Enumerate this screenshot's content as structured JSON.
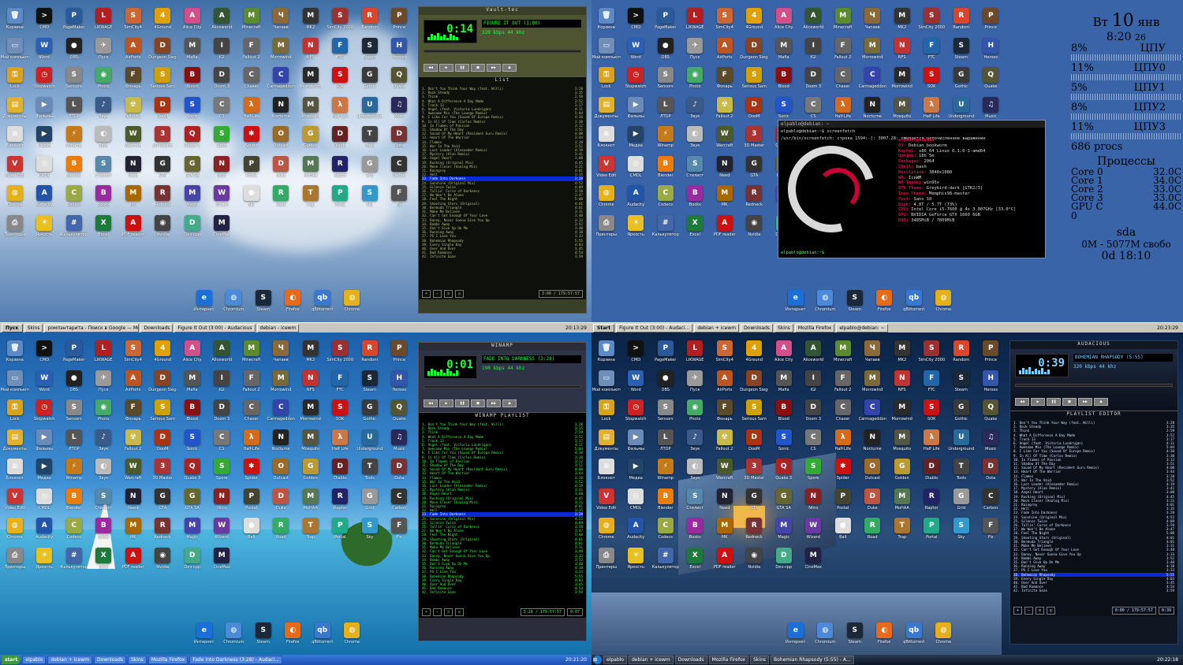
{
  "icons": [
    {
      "l": "Корзина",
      "c": "#5b8ac7",
      "g": "🗑"
    },
    {
      "l": "CMD",
      "c": "#111",
      "g": ">"
    },
    {
      "l": "PageMaker",
      "c": "#2b5a9a",
      "g": "P"
    },
    {
      "l": "LIKWAGE",
      "c": "#b02020",
      "g": "L"
    },
    {
      "l": "SimCity4",
      "c": "#cc6633",
      "g": "S"
    },
    {
      "l": "4Ground",
      "c": "#e0a000",
      "g": "4"
    },
    {
      "l": "Alice City",
      "c": "#d24f8a",
      "g": "A"
    },
    {
      "l": "Aliceworld",
      "c": "#335533",
      "g": "A"
    },
    {
      "l": "Minecraft",
      "c": "#5c8a2e",
      "g": "M"
    },
    {
      "l": "Чапаев",
      "c": "#8b6a3a",
      "g": "Ч"
    },
    {
      "l": "MK2",
      "c": "#333",
      "g": "M"
    },
    {
      "l": "SimCity 2000",
      "c": "#9b3030",
      "g": "S"
    },
    {
      "l": "Random",
      "c": "#d8462b",
      "g": "R"
    },
    {
      "l": "Prince",
      "c": "#6a4a2a",
      "g": "P"
    },
    {
      "l": "Мой компьютер",
      "c": "#6f8fb8",
      "g": "▭"
    },
    {
      "l": "Word",
      "c": "#2b5fb4",
      "g": "W"
    },
    {
      "l": "OBS",
      "c": "#222",
      "g": "●"
    },
    {
      "l": "Пуск",
      "c": "#999",
      "g": "✈"
    },
    {
      "l": "AirPorts",
      "c": "#bb5522",
      "g": "A"
    },
    {
      "l": "Dungeon Siege",
      "c": "#884422",
      "g": "D"
    },
    {
      "l": "Mafia",
      "c": "#555",
      "g": "M"
    },
    {
      "l": "IGI",
      "c": "#444",
      "g": "I"
    },
    {
      "l": "Fallout 2",
      "c": "#666",
      "g": "F"
    },
    {
      "l": "Morrowind",
      "c": "#7a6a3a",
      "g": "M"
    },
    {
      "l": "NFS",
      "c": "#c03333",
      "g": "N"
    },
    {
      "l": "FTC",
      "c": "#2266aa",
      "g": "F"
    },
    {
      "l": "Steam",
      "c": "#1b2838",
      "g": "S"
    },
    {
      "l": "Heroes",
      "c": "#3355aa",
      "g": "H"
    },
    {
      "l": "Lock",
      "c": "#d7a21e",
      "g": "⚿"
    },
    {
      "l": "Stopwatch",
      "c": "#c22",
      "g": "◷"
    },
    {
      "l": "Sensors",
      "c": "#888",
      "g": "S"
    },
    {
      "l": "Photo",
      "c": "#4a6",
      "g": "◉"
    },
    {
      "l": "Фонарь",
      "c": "#5a4a2a",
      "g": "F"
    },
    {
      "l": "Serious Sam",
      "c": "#d0a000",
      "g": "S"
    },
    {
      "l": "Blood",
      "c": "#8a1010",
      "g": "B"
    },
    {
      "l": "Doom 3",
      "c": "#444",
      "g": "D"
    },
    {
      "l": "Chaser",
      "c": "#666",
      "g": "C"
    },
    {
      "l": "Carmageddon",
      "c": "#3344aa",
      "g": "C"
    },
    {
      "l": "Morrowind",
      "c": "#2a2a2a",
      "g": "M"
    },
    {
      "l": "SOK",
      "c": "#c11",
      "g": "S"
    },
    {
      "l": "Gothic",
      "c": "#3a3a3a",
      "g": "G"
    },
    {
      "l": "Quake",
      "c": "#553",
      "g": "Q"
    },
    {
      "l": "Документы",
      "c": "#e0b030",
      "g": "▤"
    },
    {
      "l": "Фильмы",
      "c": "#6a8ab8",
      "g": "▶"
    },
    {
      "l": "ЛТОР",
      "c": "#555",
      "g": "L"
    },
    {
      "l": "Звук",
      "c": "#3a5a8a",
      "g": "♪"
    },
    {
      "l": "Fallout 2",
      "c": "#c9b94a",
      "g": "☢"
    },
    {
      "l": "DooM",
      "c": "#aa3311",
      "g": "D"
    },
    {
      "l": "Sonic",
      "c": "#2255cc",
      "g": "S"
    },
    {
      "l": "CS",
      "c": "#777",
      "g": "C"
    },
    {
      "l": "Half-Life",
      "c": "#d36b1a",
      "g": "λ"
    },
    {
      "l": "Nocturne",
      "c": "#222",
      "g": "N"
    },
    {
      "l": "Mosquito",
      "c": "#554",
      "g": "M"
    },
    {
      "l": "Half Life",
      "c": "#c74",
      "g": "λ"
    },
    {
      "l": "Underground",
      "c": "#2a6a9a",
      "g": "U"
    },
    {
      "l": "Music",
      "c": "#2a2a5a",
      "g": "♫"
    },
    {
      "l": "Блокнот",
      "c": "#ddd",
      "g": "≡"
    },
    {
      "l": "Медиа",
      "c": "#246",
      "g": "▶"
    },
    {
      "l": "Winamp",
      "c": "#c57a1a",
      "g": "⚡"
    },
    {
      "l": "Звук",
      "c": "#bbb",
      "g": "◐"
    },
    {
      "l": "Warcraft",
      "c": "#4a5a2a",
      "g": "W"
    },
    {
      "l": "3D Master",
      "c": "#a33",
      "g": "3"
    },
    {
      "l": "Quake 3",
      "c": "#a22",
      "g": "Q"
    },
    {
      "l": "Spore",
      "c": "#3a3",
      "g": "S"
    },
    {
      "l": "Spider",
      "c": "#c11",
      "g": "✱"
    },
    {
      "l": "Outcast",
      "c": "#9a6a2a",
      "g": "O"
    },
    {
      "l": "Golden",
      "c": "#b93",
      "g": "G"
    },
    {
      "l": "Diablo",
      "c": "#622",
      "g": "D"
    },
    {
      "l": "Tools",
      "c": "#444",
      "g": "T"
    },
    {
      "l": "Dota",
      "c": "#733",
      "g": "D"
    },
    {
      "l": "Video Edit",
      "c": "#c33",
      "g": "V"
    },
    {
      "l": "CMDL",
      "c": "#ddd",
      "g": "◎"
    },
    {
      "l": "Blender",
      "c": "#e87d0d",
      "g": "B"
    },
    {
      "l": "Стилист",
      "c": "#58a",
      "g": "S"
    },
    {
      "l": "Need",
      "c": "#223",
      "g": "N"
    },
    {
      "l": "GTA",
      "c": "#333",
      "g": "G"
    },
    {
      "l": "GTA SA",
      "c": "#663",
      "g": "G"
    },
    {
      "l": "Nitro",
      "c": "#822",
      "g": "N"
    },
    {
      "l": "Postal",
      "c": "#443",
      "g": "P"
    },
    {
      "l": "Duke",
      "c": "#b54",
      "g": "D"
    },
    {
      "l": "MoHAA",
      "c": "#575",
      "g": "M"
    },
    {
      "l": "Raptor",
      "c": "#226",
      "g": "R"
    },
    {
      "l": "Grid",
      "c": "#999",
      "g": "G"
    },
    {
      "l": "Carbon",
      "c": "#333",
      "g": "C"
    },
    {
      "l": "Chrome",
      "c": "#e4b01b",
      "g": "◍"
    },
    {
      "l": "Audacity",
      "c": "#2255aa",
      "g": "A"
    },
    {
      "l": "Codecs",
      "c": "#9a4",
      "g": "C"
    },
    {
      "l": "Books",
      "c": "#9a2aa0",
      "g": "B"
    },
    {
      "l": "MK",
      "c": "#a60",
      "g": "M"
    },
    {
      "l": "Redneck",
      "c": "#733",
      "g": "R"
    },
    {
      "l": "Magic",
      "c": "#44a",
      "g": "M"
    },
    {
      "l": "Wizard",
      "c": "#6a3aa0",
      "g": "W"
    },
    {
      "l": "Ball",
      "c": "#ddd",
      "g": "●"
    },
    {
      "l": "Road",
      "c": "#3a6",
      "g": "R"
    },
    {
      "l": "Trap",
      "c": "#a73",
      "g": "T"
    },
    {
      "l": "Portal",
      "c": "#2a8",
      "g": "P"
    },
    {
      "l": "Sky",
      "c": "#39c",
      "g": "S"
    },
    {
      "l": "Fix",
      "c": "#555",
      "g": "F"
    },
    {
      "l": "Принтеры",
      "c": "#888",
      "g": "⎙"
    },
    {
      "l": "Яркость",
      "c": "#e8c020",
      "g": "☀"
    },
    {
      "l": "Калькулятор",
      "c": "#46a",
      "g": "#"
    },
    {
      "l": "Excel",
      "c": "#1d7a3a",
      "g": "X"
    },
    {
      "l": "PDF reader",
      "c": "#c11",
      "g": "A"
    },
    {
      "l": "Nvidia",
      "c": "#444",
      "g": "◉"
    },
    {
      "l": "Dev-cpp",
      "c": "#4a8",
      "g": "D"
    },
    {
      "l": "CineMax",
      "c": "#224",
      "g": "M"
    }
  ],
  "bottom_icons": [
    {
      "l": "Интернет",
      "c": "#1c6fd6",
      "g": "e"
    },
    {
      "l": "Chromium",
      "c": "#4a8ad8",
      "g": "◍"
    },
    {
      "l": "Steam",
      "c": "#1b2838",
      "g": "S"
    },
    {
      "l": "Firefox",
      "c": "#e76a1b",
      "g": "◐"
    },
    {
      "l": "qBittorrent",
      "c": "#3a78d0",
      "g": "qb"
    },
    {
      "l": "Chrome",
      "c": "#e4b01b",
      "g": "◍"
    }
  ],
  "top_left": {
    "player_title": "Vault-tec",
    "time": "0:14",
    "marquee": "FIGURE IT OUT (3:00)",
    "kbps": "320",
    "khz": "44",
    "playlist_title": "List",
    "total": "3:00 / 179:57:57",
    "taskbar": {
      "start": "Пуск",
      "buttons": [
        "Skins",
        "ромпэнтарита - Поиск в Google — Mozill...",
        "Downloads",
        "Figure It Out (3:00) - Audacious",
        "debian - icewm"
      ],
      "clock": "20:13:29"
    }
  },
  "top_right": {
    "terminal": {
      "title": "elpablo@debian: ~",
      "cmd": "elpablo@debian:~$ screenfetch",
      "warn": "/usr/bin/screenfetch: строка 1594: [: 3007.28: ожидается целочисленное выражение",
      "user": "elpablo@debian",
      "info": [
        [
          "OS:",
          "Debian bookworm"
        ],
        [
          "Kernel:",
          "x86_64 Linux 6.1.0-1-amd64"
        ],
        [
          "Uptime:",
          "18h 5m"
        ],
        [
          "Packages:",
          "2064"
        ],
        [
          "Shell:",
          "bash"
        ],
        [
          "Resolution:",
          "3840x1080"
        ],
        [
          "WM:",
          "IceWM"
        ],
        [
          "WM Theme:",
          "win95x"
        ],
        [
          "GTK Theme:",
          "Greybird-dark [GTK2/3]"
        ],
        [
          "Icon Theme:",
          "Memphis98-master"
        ],
        [
          "Font:",
          "Sans 10"
        ],
        [
          "Disk:",
          "4.8T / 5.7T (73%)"
        ],
        [
          "CPU:",
          "Intel Core i5-7600 @ 4x 3.007GHz [33.0°C]"
        ],
        [
          "GPU:",
          "NVIDIA GeForce GTX 1060 6GB"
        ],
        [
          "RAM:",
          "3485MiB / 7809MiB"
        ]
      ],
      "prompt": "elpablo@debian:~$"
    },
    "conky": {
      "day": "Вт",
      "date": "10",
      "month": "янв",
      "time": "8:20",
      "seconds": "26",
      "cpu": [
        [
          "8%",
          "ЦПУ"
        ],
        [
          "11%",
          "ЦПУ0"
        ],
        [
          "5%",
          "ЦПУ1"
        ],
        [
          "8%",
          "ЦПУ2"
        ],
        [
          "11%",
          "ЦПУ3"
        ]
      ],
      "procs": "686 procs",
      "procs_label": "Процессы",
      "temps": [
        [
          "Core 0",
          "32.0C"
        ],
        [
          "Core 1",
          "34.0C"
        ],
        [
          "Core 2",
          "33.0C"
        ],
        [
          "Core 3",
          "33.0C"
        ],
        [
          "GPU C",
          "44.0C"
        ]
      ],
      "zero": "0",
      "disk": "sda",
      "disk_free": "0M - 5077M свобо",
      "uptime": "0d 18:10"
    },
    "taskbar": {
      "start": "Start",
      "buttons": [
        "Figure It Out (3:00) - Audaci...",
        "debian + icewm",
        "Downloads",
        "Skins",
        "Mozilla Firefox",
        "elpablo@debian: ~"
      ],
      "clock": "20:23:29"
    }
  },
  "bottom_left": {
    "player_title": "WINAMP",
    "time": "0:01",
    "marquee": "FADE INTO DARKNESS (3:28)",
    "kbps": "190",
    "khz": "44",
    "playlist_title": "WINAMP PLAYLIST",
    "total": "3:28 / 179:57:57",
    "pos": "0:07",
    "taskbar": {
      "start": "start",
      "buttons": [
        "elpablo",
        "debian + icewm",
        "Downloads",
        "Skins",
        "Mozilla Firefox",
        "Fade Into Darkness (3:28) - Audaci..."
      ],
      "clock": "20:21:20"
    }
  },
  "bottom_right": {
    "player_title": "AUDACIOUS",
    "time": "0:39",
    "marquee": "BOHEMIAN RHAPSODY (5:55)",
    "kbps": "320",
    "khz": "44",
    "playlist_title": "PLAYLIST EDITOR",
    "total": "0:00 / 179:57:57",
    "pos": "0:39",
    "taskbar": {
      "start": "⊞",
      "buttons": [
        "elpablo",
        "debian + icewm",
        "Downloads",
        "Mozilla Firefox",
        "Skins",
        "Bohemian Rhapsody (5:55) - A..."
      ],
      "clock": "20:22:18"
    }
  },
  "playlist": [
    [
      "Don't You Think Your Way (feat. Willi)",
      "3:28"
    ],
    [
      "Rock Steady",
      "3:35"
    ],
    [
      "Think",
      "2:59"
    ],
    [
      "What A Difference A Day Made",
      "3:52"
    ],
    [
      "Track 13",
      "3:17"
    ],
    [
      "Angel (feat. Victoria Lundrigan)",
      "4:11"
    ],
    [
      "Awesome Mix (The Lounge Remix)",
      "5:04"
    ],
    [
      "I Like For You (Sound Of Europe Remix)",
      "4:30"
    ],
    [
      "In All Of Time (Carlos Remix)",
      "3:30"
    ],
    [
      "In Flames of Passion",
      "3:12"
    ],
    [
      "Shadow Of The Day",
      "3:51"
    ],
    [
      "Sound Of My Heart (Resident Guru Remix)",
      "4:00"
    ],
    [
      "Heart Of The Warrior",
      "3:44"
    ],
    [
      "Flames",
      "3:20"
    ],
    [
      "War In The Void",
      "3:52"
    ],
    [
      "Lost Leader (Alexander Remix)",
      "4:19"
    ],
    [
      "Mystery (Alan Remix)",
      "3:41"
    ],
    [
      "Angel Heart",
      "3:08"
    ],
    [
      "Rushing (Original Mix)",
      "4:45"
    ],
    [
      "Move Closer (Analog Mix)",
      "3:21"
    ],
    [
      "Raingrey",
      "4:01"
    ],
    [
      "Hell",
      "3:35"
    ],
    [
      "Fade Into Darkness",
      "3:28"
    ],
    [
      "Sunshine (Original Mix)",
      "4:52"
    ],
    [
      "Silence Twice",
      "4:09"
    ],
    [
      "Tallin' Curse of Darkness",
      "3:58"
    ],
    [
      "We Won't Be Alone",
      "3:47"
    ],
    [
      "Feel The Night",
      "5:08"
    ],
    [
      "Shooting Stars (Original)",
      "4:01"
    ],
    [
      "Bermuda Triangle",
      "4:01"
    ],
    [
      "Make Me Believe",
      "3:31"
    ],
    [
      "Can't Get Enough Of Your Love",
      "3:40"
    ],
    [
      "Danny, Never Gonna Give You Up",
      "3:33"
    ],
    [
      "Bombs Away",
      "3:52"
    ],
    [
      "Don't Give Up On Me",
      "3:40"
    ],
    [
      "Running Away",
      "4:10"
    ],
    [
      "PS I Love You",
      "3:33"
    ],
    [
      "Bohemian Rhapsody",
      "5:55"
    ],
    [
      "Every Single Day",
      "4:03"
    ],
    [
      "Over And Over",
      "3:45"
    ],
    [
      "Bad Romance",
      "4:54"
    ],
    [
      "Infinite Gaze",
      "3:59"
    ]
  ],
  "playlist_current": {
    "tl": 22,
    "bl": 22,
    "br": 37
  }
}
